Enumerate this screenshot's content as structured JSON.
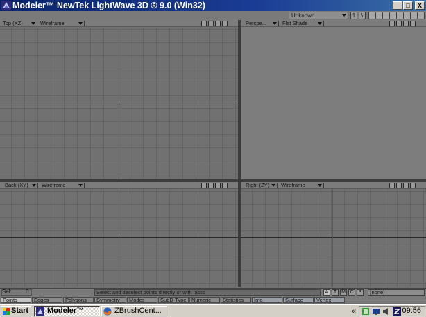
{
  "window": {
    "title": "Modeler™ NewTek LightWave 3D ® 9.0 (Win32)",
    "buttons": {
      "minimize": "_",
      "maximize": "□",
      "close": "X"
    }
  },
  "topbar": {
    "units": "Unknown",
    "layer_buttons": [
      "1",
      "\\"
    ]
  },
  "viewports": {
    "top": {
      "view": "Top (XZ)",
      "mode": "Wireframe"
    },
    "perspective": {
      "view": "Perspe...",
      "mode": "Flat Shade"
    },
    "back": {
      "view": "Back (XY)",
      "mode": "Wireframe"
    },
    "right": {
      "view": "Right (ZY)",
      "mode": "Wireframe"
    }
  },
  "status": {
    "sel_label": "Sel:",
    "sel_count": "0",
    "hint": "Select and deselect points directly or with lasso",
    "modes": [
      "A",
      "T",
      "M",
      "C",
      "S"
    ],
    "active_mode": "A",
    "dropdown": "(none)"
  },
  "tabs": [
    "Points",
    "Edges",
    "Polygons",
    "Symmetry",
    "Modes",
    "SubD-Type",
    "Numeric",
    "Statistics",
    "Info",
    "Surface",
    "Vertex"
  ],
  "active_tab": "Points",
  "taskbar": {
    "start": "Start",
    "tasks": [
      "Modeler™",
      "ZBrushCent..."
    ],
    "tray_arrow": "«",
    "clock": "09:56"
  },
  "colors": {
    "titlebar": "#0a246a",
    "viewport_bg": "#717171",
    "taskbar": "#d4d0c8"
  },
  "icons": [
    "lightwave-icon",
    "firefox-icon",
    "windows-logo-icon"
  ]
}
